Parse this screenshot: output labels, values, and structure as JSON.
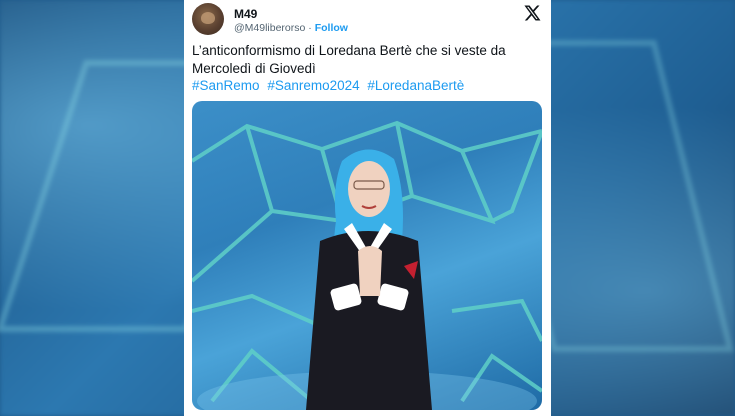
{
  "tweet": {
    "author_name": "M49",
    "author_handle": "@M49liberorso",
    "separator": " · ",
    "follow_label": "Follow",
    "text_line1": "L’anticonformismo di Loredana Bertè che si veste da",
    "text_line2": "Mercoledì di Giovedì",
    "hashtags": [
      "#SanRemo",
      "#Sanremo2024",
      "#LoredanaBertè"
    ]
  },
  "icons": {
    "platform": "x-logo-icon",
    "avatar": "avatar-image"
  },
  "colors": {
    "link": "#1d9bf0",
    "text": "#0f1419",
    "muted": "#536471",
    "backdrop": "#1e5a8c"
  }
}
